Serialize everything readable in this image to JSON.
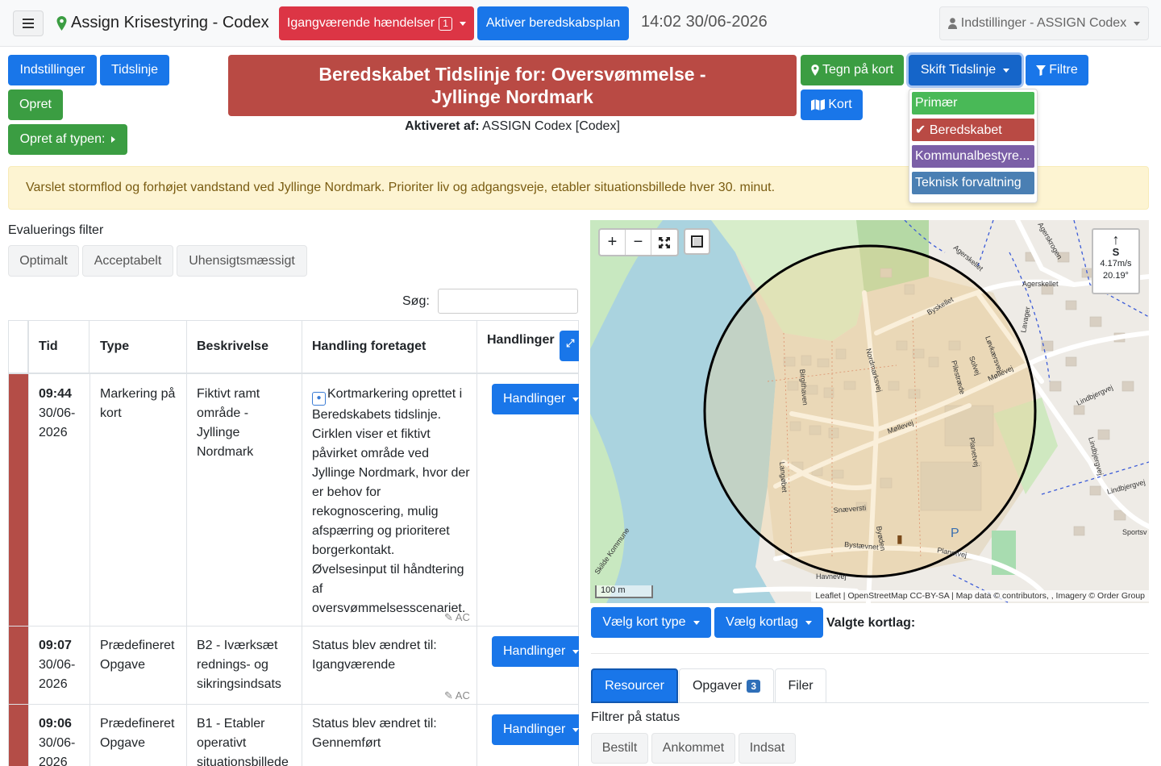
{
  "header": {
    "app_title": "Assign Krisestyring - Codex",
    "ongoing_label": "Igangværende hændelser",
    "ongoing_count": "1",
    "activate_plan_label": "Aktiver beredskabsplan",
    "datetime": "14:02 30/06-2026",
    "settings_menu_label": "Indstillinger - ASSIGN Codex"
  },
  "toolbar": {
    "settings_label": "Indstillinger",
    "timeline_label": "Tidslinje",
    "create_label": "Opret",
    "create_by_type_label": "Opret af typen:",
    "draw_map_label": "Tegn på kort",
    "map_label": "Kort",
    "switch_timeline_label": "Skift Tidslinje",
    "filters_label": "Filtre"
  },
  "timeline_menu": [
    {
      "label": "Primær",
      "color": "#49b957"
    },
    {
      "label": "✔ Beredskabet",
      "color": "#b94a44"
    },
    {
      "label": "Kommunalbestyre...",
      "color": "#7b5fa7"
    },
    {
      "label": "Teknisk forvaltning",
      "color": "#4a7fb3"
    }
  ],
  "banner": {
    "title": "Beredskabet Tidslinje for: Oversvømmelse - Jyllinge Nordmark",
    "activated_by_label": "Aktiveret af:",
    "activated_by_value": " ASSIGN Codex [Codex]"
  },
  "alert_text": "Varslet stormflod og forhøjet vandstand ved Jyllinge Nordmark. Prioriter liv og adgangsveje, etabler situationsbillede hver 30. minut.",
  "evaluation": {
    "label": "Evaluerings filter",
    "options": [
      "Optimalt",
      "Acceptabelt",
      "Uhensigtsmæssigt"
    ]
  },
  "search": {
    "label": "Søg:",
    "value": ""
  },
  "table": {
    "headers": [
      "Tid",
      "Type",
      "Beskrivelse",
      "Handling foretaget",
      "Handlinger"
    ],
    "rows": [
      {
        "time": "09:44",
        "date1": "30/06-",
        "date2": "2026",
        "type": "Markering på kort",
        "description": "Fiktivt ramt område - Jyllinge Nordmark",
        "action": "Kortmarkering oprettet i Beredskabets tidslinje. Cirklen viser et fiktivt påvirket område ved Jyllinge Nordmark, hvor der er behov for rekognoscering, mulig afspærring og prioriteret borgerkontakt. Øvelsesinput til håndtering af oversvømmelsesscenariet.",
        "author": "✎ AC",
        "button": "Handlinger"
      },
      {
        "time": "09:07",
        "date1": "30/06-",
        "date2": "2026",
        "type": "Prædefineret Opgave",
        "description": "B2 - Iværksæt rednings- og sikringsindsats",
        "action": "Status blev ændret til: Igangværende",
        "author": "✎ AC",
        "button": "Handlinger"
      },
      {
        "time": "09:06",
        "date1": "30/06-",
        "date2": "2026",
        "type": "Prædefineret Opgave",
        "description": "B1 - Etabler operativt situationsbillede",
        "action": "Status blev ændret til: Gennemført",
        "author": "",
        "button": "Handlinger"
      }
    ]
  },
  "map": {
    "scale_label": "100 m",
    "attribution": "Leaflet | OpenStreetMap CC-BY-SA | Map data © contributors, , Imagery © Order Group",
    "wind_direction": "S",
    "wind_speed": "4.17m/s",
    "wind_degree": "20.19°",
    "zoom_in": "+",
    "zoom_out": "−",
    "streets": [
      "Agerskellet",
      "Agerskellet",
      "Agerskrogen",
      "Byskellet",
      "Løvkærsvej",
      "Solvej",
      "Nordmarksvej",
      "Birgithaven",
      "Pilestræde",
      "Møllevej",
      "Møllevej",
      "Lindbjergvej",
      "Lindbjergvej",
      "Lindbjergvej",
      "Lavager",
      "Langøbet",
      "Planetvej",
      "Snæversti",
      "Bystævnet",
      "Byøden",
      "Planetvej",
      "Havnevej",
      "Sportsv",
      "Skilde Kommune"
    ],
    "parking_label": "P",
    "select_type_label": "Vælg kort type",
    "select_layer_label": "Vælg kortlag",
    "selected_layers_label": "Valgte kortlag:"
  },
  "tabs": [
    {
      "label": "Resourcer",
      "badge": ""
    },
    {
      "label": "Opgaver",
      "badge": "3"
    },
    {
      "label": "Filer",
      "badge": ""
    }
  ],
  "status_filter": {
    "label": "Filtrer på status",
    "options": [
      "Bestilt",
      "Ankommet",
      "Indsat"
    ]
  }
}
